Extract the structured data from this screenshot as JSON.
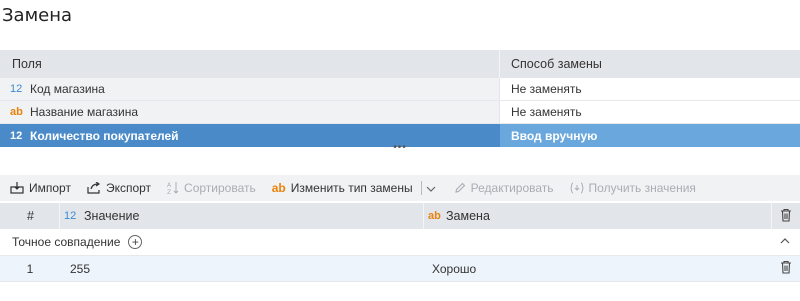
{
  "page": {
    "title": "Замена"
  },
  "fields_table": {
    "headers": {
      "fields": "Поля",
      "method": "Способ замены"
    },
    "rows": [
      {
        "type_icon": "12",
        "type": "numeric",
        "name": "Код магазина",
        "method": "Не заменять",
        "selected": false
      },
      {
        "type_icon": "ab",
        "type": "text",
        "name": "Название магазина",
        "method": "Не заменять",
        "selected": false
      },
      {
        "type_icon": "12",
        "type": "numeric",
        "name": "Количество покупателей",
        "method": "Ввод вручную",
        "selected": true
      }
    ]
  },
  "toolbar": {
    "import": "Импорт",
    "export": "Экспорт",
    "sort": "Сортировать",
    "change_type_icon": "ab",
    "change_type": "Изменить тип замены",
    "edit": "Редактировать",
    "get_values": "Получить значения"
  },
  "replacement_table": {
    "headers": {
      "num": "#",
      "value_icon": "12",
      "value": "Значение",
      "replacement_icon": "ab",
      "replacement": "Замена"
    },
    "group": {
      "label": "Точное совпадение"
    },
    "rows": [
      {
        "num": "1",
        "value": "255",
        "replacement": "Хорошо"
      }
    ]
  },
  "colors": {
    "selected_row": "#4a8ac8",
    "selected_cell": "#6aa7dc",
    "header_bg": "#e2e5ea",
    "numeric_icon": "#3b89d1",
    "text_icon": "#e8830e"
  }
}
